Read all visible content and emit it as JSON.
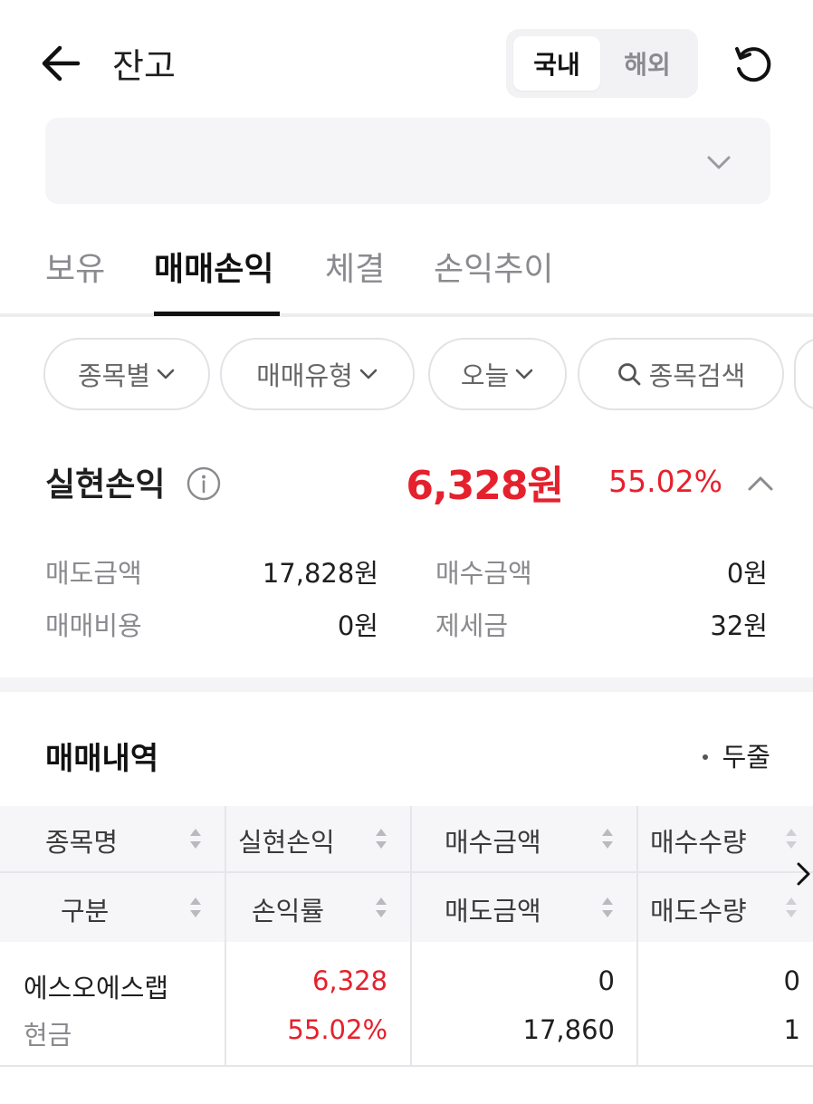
{
  "header": {
    "title": "잔고",
    "segments": [
      "국내",
      "해외"
    ],
    "active_segment": "국내"
  },
  "tabs": [
    "보유",
    "매매손익",
    "체결",
    "손익추이"
  ],
  "active_tab": "매매손익",
  "filters": {
    "by_stock": "종목별",
    "trade_type": "매매유형",
    "period": "오늘",
    "search": "종목검색"
  },
  "realized": {
    "label": "실현손익",
    "amount": "6,328원",
    "rate": "55.02%",
    "sell_amount_label": "매도금액",
    "sell_amount": "17,828원",
    "buy_amount_label": "매수금액",
    "buy_amount": "0원",
    "trade_cost_label": "매매비용",
    "trade_cost": "0원",
    "tax_label": "제세금",
    "tax": "32원"
  },
  "history": {
    "title": "매매내역",
    "view_toggle": "두줄",
    "headers_row1": [
      "종목명",
      "실현손익",
      "매수금액",
      "매수수량"
    ],
    "headers_row2": [
      "구분",
      "손익률",
      "매도금액",
      "매도수량"
    ],
    "rows": [
      {
        "name": "에스오에스랩",
        "type": "현금",
        "realized": "6,328",
        "rate": "55.02%",
        "buy_amount": "0",
        "sell_amount": "17,860",
        "buy_qty": "0",
        "sell_qty": "1"
      }
    ]
  },
  "colors": {
    "profit": "#e5212d",
    "muted": "#8a8a8f",
    "text": "#1f1f1f"
  }
}
